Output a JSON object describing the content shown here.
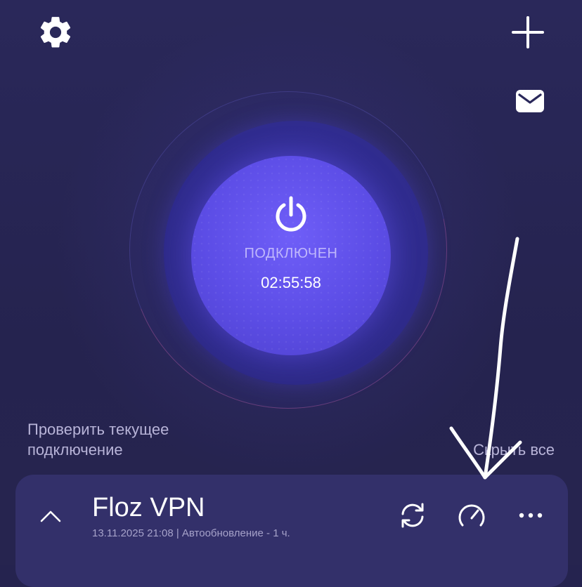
{
  "main": {
    "status": "ПОДКЛЮЧЕН",
    "timer": "02:55:58",
    "check_connection": "Проверить текущее подключение",
    "hide_all": "Скрыть все"
  },
  "profile": {
    "name": "Floz VPN",
    "meta": "13.11.2025 21:08 | Автообновление - 1 ч."
  },
  "icons": {
    "settings": "gear-icon",
    "add": "plus-icon",
    "messages": "envelope-icon",
    "power": "power-icon",
    "collapse": "chevron-up-icon",
    "refresh": "refresh-icon",
    "speed_test": "speedometer-icon",
    "more": "more-dots-icon"
  },
  "colors": {
    "background": "#25234f",
    "button_accent": "#5c4de6",
    "card": "#33306a"
  }
}
